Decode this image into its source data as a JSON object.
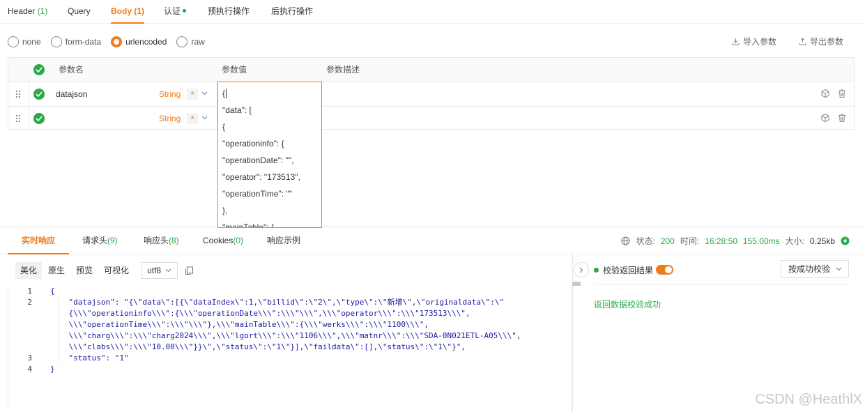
{
  "request_tabs": [
    {
      "label": "Header",
      "count": "(1)"
    },
    {
      "label": "Query",
      "count": ""
    },
    {
      "label": "Body",
      "count": "(1)"
    },
    {
      "label": "认证",
      "count": ""
    },
    {
      "label": "预执行操作",
      "count": ""
    },
    {
      "label": "后执行操作",
      "count": ""
    }
  ],
  "body_types": [
    "none",
    "form-data",
    "urlencoded",
    "raw"
  ],
  "body_selected": "urlencoded",
  "actions": {
    "import": "导入参数",
    "export": "导出参数"
  },
  "params_table": {
    "headers": {
      "name": "参数名",
      "value": "参数值",
      "desc": "参数描述"
    },
    "rows": [
      {
        "name": "datajson",
        "type": "String",
        "required": "*"
      },
      {
        "name": "",
        "type": "String",
        "required": "*"
      }
    ]
  },
  "value_editor_lines": [
    "{",
    "\"data\": [",
    "{",
    "\"operationinfo\": {",
    "\"operationDate\": \"\",",
    "\"operator\": \"173513\",",
    "\"operationTime\": \"\"",
    "},",
    "\"mainTable\": {"
  ],
  "response_tabs": [
    {
      "label": "实时响应",
      "count": ""
    },
    {
      "label": "请求头",
      "count": "(9)"
    },
    {
      "label": "响应头",
      "count": "(8)"
    },
    {
      "label": "Cookies",
      "count": "(0)"
    },
    {
      "label": "响应示例",
      "count": ""
    }
  ],
  "status": {
    "status_label": "状态:",
    "status_value": "200",
    "time_label": "时间:",
    "time_value": "16:28:50",
    "duration": "155.00ms",
    "size_label": "大小:",
    "size_value": "0.25kb"
  },
  "view_modes": [
    "美化",
    "原生",
    "预览",
    "可视化"
  ],
  "encoding": "utf8",
  "code": {
    "line_numbers": [
      "1",
      "2",
      "",
      "",
      "",
      "",
      "3",
      "4"
    ],
    "lines": [
      "{",
      "    \"datajson\": \"{\\\"data\\\":[{\\\"dataIndex\\\":1,\\\"billid\\\":\\\"2\\\",\\\"type\\\":\\\"新增\\\",\\\"originaldata\\\":\\\"",
      "    {\\\\\\\"operationinfo\\\\\\\":{\\\\\\\"operationDate\\\\\\\":\\\\\\\"\\\\\\\",\\\\\\\"operator\\\\\\\":\\\\\\\"173513\\\\\\\",",
      "    \\\\\\\"operationTime\\\\\\\":\\\\\\\"\\\\\\\"},\\\\\\\"mainTable\\\\\\\":{\\\\\\\"werks\\\\\\\":\\\\\\\"1100\\\\\\\",",
      "    \\\\\\\"charg\\\\\\\":\\\\\\\"charg2024\\\\\\\",\\\\\\\"lgort\\\\\\\":\\\\\\\"1106\\\\\\\",\\\\\\\"matnr\\\\\\\":\\\\\\\"SDA-0N021ETL-A05\\\\\\\",",
      "    \\\\\\\"clabs\\\\\\\":\\\\\\\"10.00\\\\\\\"}}\\\",\\\"status\\\":\\\"1\\\"}],\\\"faildata\\\":[],\\\"status\\\":\\\"1\\\"}\",",
      "    \"status\": \"1\"",
      "}"
    ]
  },
  "validation": {
    "label": "校验返回结果",
    "mode": "按成功校验",
    "result": "返回数据校验成功"
  },
  "watermark": "CSDN @HeathlX",
  "colors": {
    "accent": "#f07d1a",
    "success": "#2ba84a"
  }
}
